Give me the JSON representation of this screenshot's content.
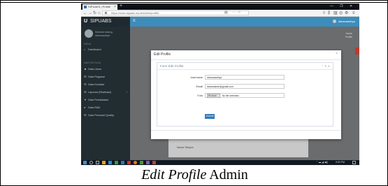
{
  "browser": {
    "tab_title": "SIPUAKS | Profile",
    "new_tab": "+",
    "url": "https://www.sipjaks.my.id/admin/profile",
    "window_controls": [
      "—",
      "❐",
      "✕"
    ]
  },
  "app": {
    "brand": "SIPUABS",
    "brand_icon": "U",
    "user": {
      "role": "Selamat datang,",
      "name": "dahanaadhya"
    },
    "sidebar": {
      "section_menu": "MENU",
      "dashboard": "Dashboard",
      "section_master": "MASTER DATA",
      "items": [
        {
          "icon": "users-icon",
          "label": "Data Users"
        },
        {
          "icon": "list-icon",
          "label": "Data Pegawai"
        },
        {
          "icon": "list-icon",
          "label": "Data Kendala"
        },
        {
          "icon": "list-icon",
          "label": "Laporan (Realisasi)"
        },
        {
          "icon": "filter-icon",
          "label": "Data Pembatalan"
        },
        {
          "icon": "user-icon",
          "label": "Data RAB"
        },
        {
          "icon": "list-icon",
          "label": "Data Personal Quality"
        }
      ]
    },
    "header": {
      "user": "dahanaadhya"
    },
    "breadcrumb": [
      "Home",
      "Profile"
    ],
    "background_fields": [
      {
        "label": "Username",
        "value": "dahanaadhya"
      },
      {
        "label": "Email",
        "value": "dahanatech@gmail.com"
      },
      {
        "label": "Nomor Telepon",
        "value": ""
      }
    ]
  },
  "modal": {
    "title": "Edit Profile",
    "close": "×",
    "panel_title": "Form Edit Profile",
    "panel_tools": "⌃ ✎ ✕",
    "fields": {
      "username_label": "Username",
      "username_value": "dahanaadhya",
      "email_label": "Email",
      "email_value": "dahanatech@gmail.com",
      "foto_label": "Foto",
      "browse_label": "Browse...",
      "no_file": "No file selected."
    },
    "submit": "Submit"
  },
  "taskbar": {
    "time": "9:00 PM"
  },
  "caption": {
    "italic": "Edit Profile",
    "rest": " Admin"
  }
}
